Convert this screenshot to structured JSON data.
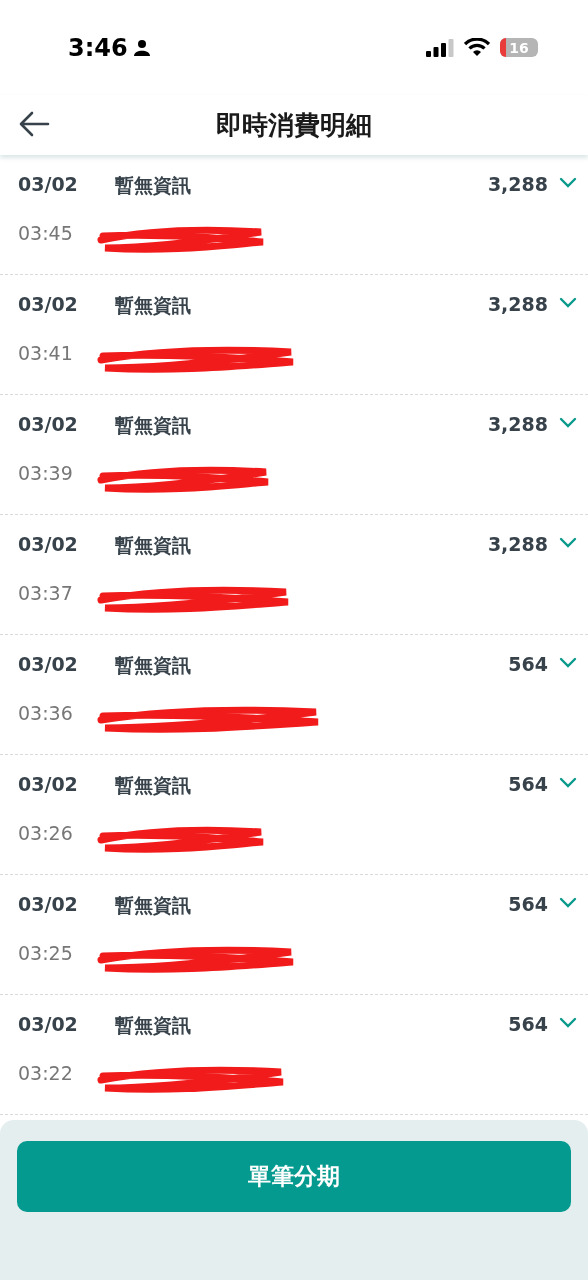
{
  "status_bar": {
    "time": "3:46",
    "battery": "16"
  },
  "header": {
    "title": "即時消費明細"
  },
  "transactions": [
    {
      "date": "03/02",
      "time": "03:45",
      "description": "暫無資訊",
      "amount": "3,288",
      "card_redacted": true
    },
    {
      "date": "03/02",
      "time": "03:41",
      "description": "暫無資訊",
      "amount": "3,288",
      "card_redacted": true
    },
    {
      "date": "03/02",
      "time": "03:39",
      "description": "暫無資訊",
      "amount": "3,288",
      "card_redacted": true
    },
    {
      "date": "03/02",
      "time": "03:37",
      "description": "暫無資訊",
      "amount": "3,288",
      "card_redacted": true
    },
    {
      "date": "03/02",
      "time": "03:36",
      "description": "暫無資訊",
      "amount": "564",
      "card_redacted": true
    },
    {
      "date": "03/02",
      "time": "03:26",
      "description": "暫無資訊",
      "amount": "564",
      "card_redacted": true
    },
    {
      "date": "03/02",
      "time": "03:25",
      "description": "暫無資訊",
      "amount": "564",
      "card_redacted": true
    },
    {
      "date": "03/02",
      "time": "03:22",
      "description": "暫無資訊",
      "amount": "564",
      "card_redacted": true
    }
  ],
  "footer": {
    "button": "單筆分期"
  }
}
